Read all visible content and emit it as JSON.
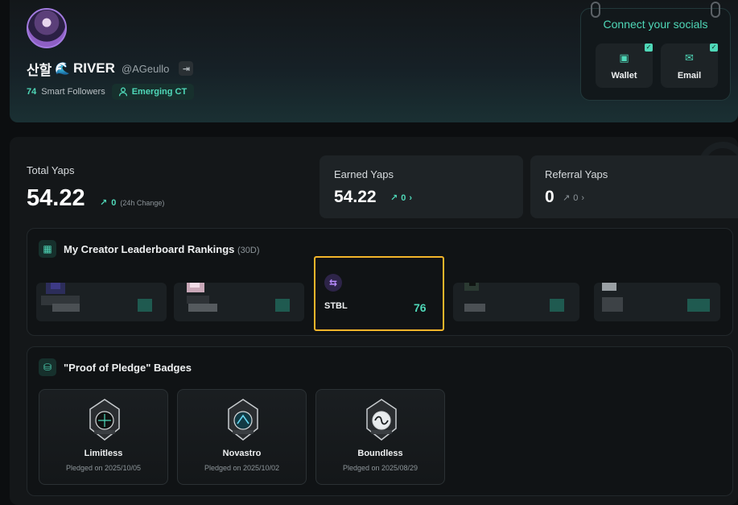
{
  "profile": {
    "name": "산할",
    "wave_icon": "wave-icon",
    "project": "RIVER",
    "handle": "@AGeullo",
    "smart_followers_count": "74",
    "smart_followers_label": "Smart Followers",
    "badge_label": "Emerging CT"
  },
  "socials": {
    "title": "Connect your socials",
    "wallet_label": "Wallet",
    "email_label": "Email"
  },
  "stats": {
    "total_title": "Total Yaps",
    "total_value": "54.22",
    "total_change": "0",
    "total_change_note": "(24h Change)",
    "earned_title": "Earned Yaps",
    "earned_value": "54.22",
    "earned_change": "0",
    "referral_title": "Referral Yaps",
    "referral_value": "0",
    "referral_change": "0"
  },
  "leaderboard": {
    "title": "My Creator Leaderboard Rankings",
    "period": "(30D)",
    "highlight_name": "STBL",
    "highlight_score": "76"
  },
  "badges": {
    "title": "\"Proof of Pledge\" Badges",
    "items": [
      {
        "name": "Limitless",
        "date": "Pledged on 2025/10/05"
      },
      {
        "name": "Novastro",
        "date": "Pledged on 2025/10/02"
      },
      {
        "name": "Boundless",
        "date": "Pledged on 2025/08/29"
      }
    ]
  },
  "colors": {
    "accent": "#4fd8b8",
    "highlight_border": "#f3b52a",
    "background": "#0c0e10"
  }
}
